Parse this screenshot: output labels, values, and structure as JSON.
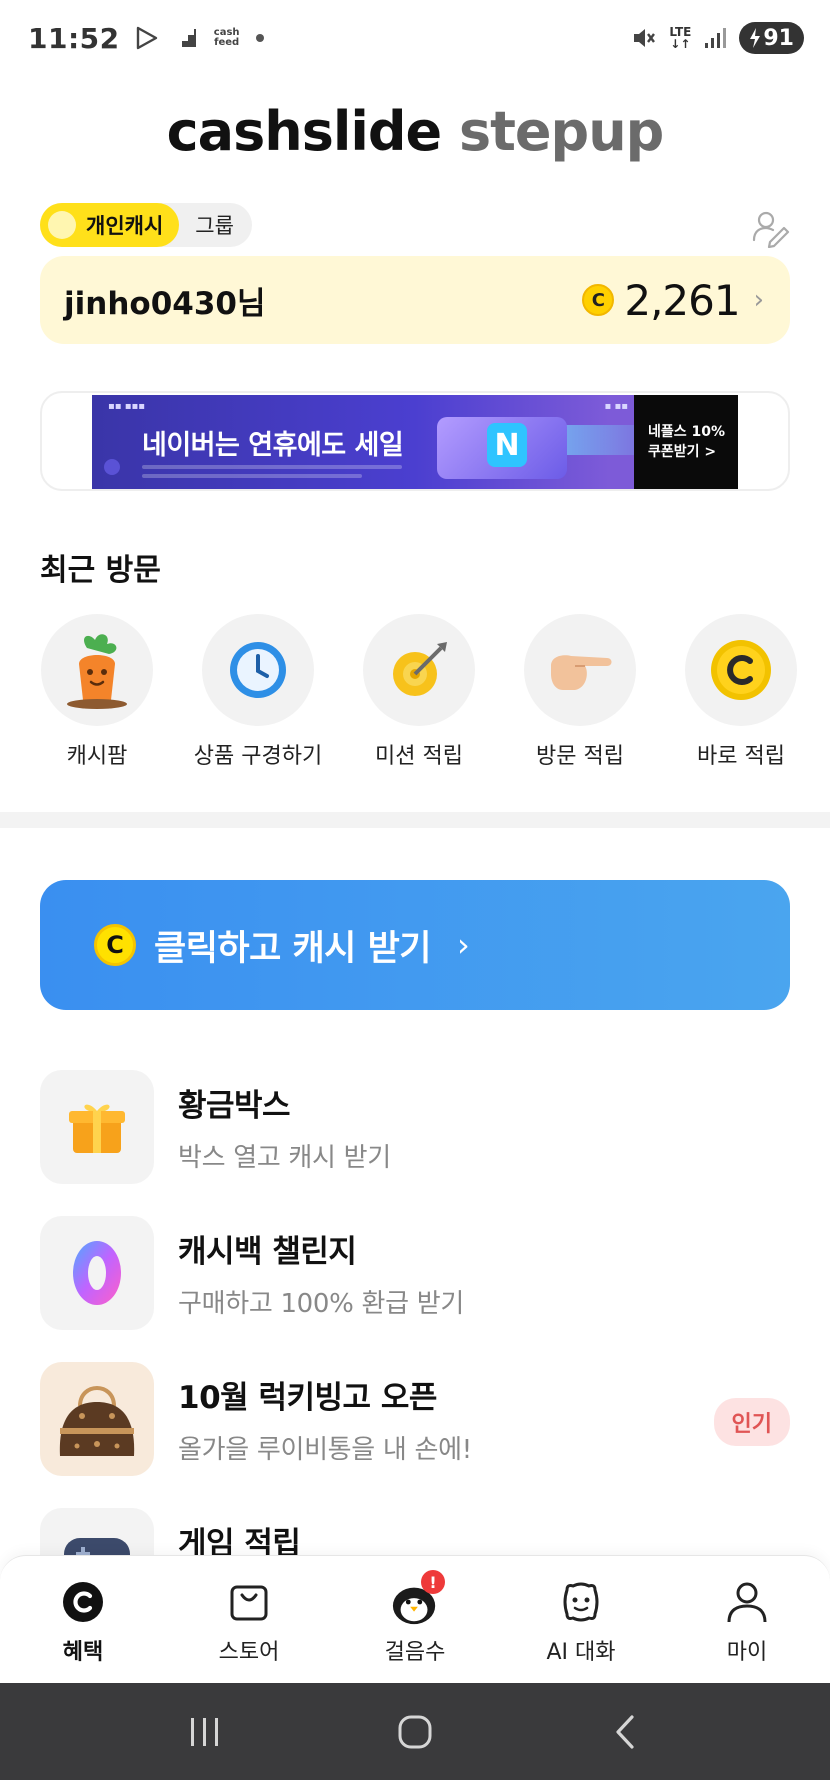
{
  "status_bar": {
    "time": "11:52",
    "network": "LTE",
    "battery": "91",
    "app_icon_label": "cash feed"
  },
  "header": {
    "logo_primary": "cashslide",
    "logo_secondary": "stepup"
  },
  "cash_toggle": {
    "personal_label": "개인캐시",
    "group_label": "그룹",
    "selected": "개인캐시"
  },
  "cash_card": {
    "username": "jinho0430님",
    "coin_symbol": "C",
    "balance": "2,261"
  },
  "banner": {
    "title": "네이버는 연휴에도 세일",
    "cta_line1": "네플스 10%",
    "cta_line2": "쿠폰받기 >",
    "logo_letter": "N"
  },
  "recent": {
    "title": "최근 방문",
    "items": [
      {
        "label": "캐시팜",
        "icon": "carrot-icon"
      },
      {
        "label": "상품 구경하기",
        "icon": "clock-icon"
      },
      {
        "label": "미션 적립",
        "icon": "target-icon"
      },
      {
        "label": "방문 적립",
        "icon": "pointing-hand-icon"
      },
      {
        "label": "바로 적립",
        "icon": "coin-icon"
      }
    ]
  },
  "click_cash": {
    "coin_symbol": "C",
    "label": "클릭하고 캐시 받기",
    "chevron": "›"
  },
  "features": [
    {
      "title": "황금박스",
      "subtitle": "박스 열고 캐시 받기",
      "icon": "gift-box-icon"
    },
    {
      "title": "캐시백 챌린지",
      "subtitle": "구매하고 100% 환급 받기",
      "icon": "zero-icon",
      "icon_text": "0"
    },
    {
      "title": "10월 럭키빙고 오픈",
      "subtitle": "올가을 루이비통을 내 손에!",
      "icon": "handbag-icon",
      "badge": "인기"
    },
    {
      "title": "게임 적립",
      "subtitle": "",
      "icon": "gamepad-icon"
    }
  ],
  "bottom_nav": {
    "items": [
      {
        "label": "혜택",
        "icon": "benefit-coin-icon",
        "active": true
      },
      {
        "label": "스토어",
        "icon": "store-bag-icon",
        "active": false
      },
      {
        "label": "걸음수",
        "icon": "penguin-icon",
        "active": false,
        "alert": "!"
      },
      {
        "label": "AI 대화",
        "icon": "ai-chat-icon",
        "active": false
      },
      {
        "label": "마이",
        "icon": "person-icon",
        "active": false
      }
    ]
  },
  "colors": {
    "accent_yellow": "#ffe01a",
    "card_bg": "#fff8d6",
    "click_blue": "#3a8ff0",
    "badge_red": "#e05555"
  }
}
